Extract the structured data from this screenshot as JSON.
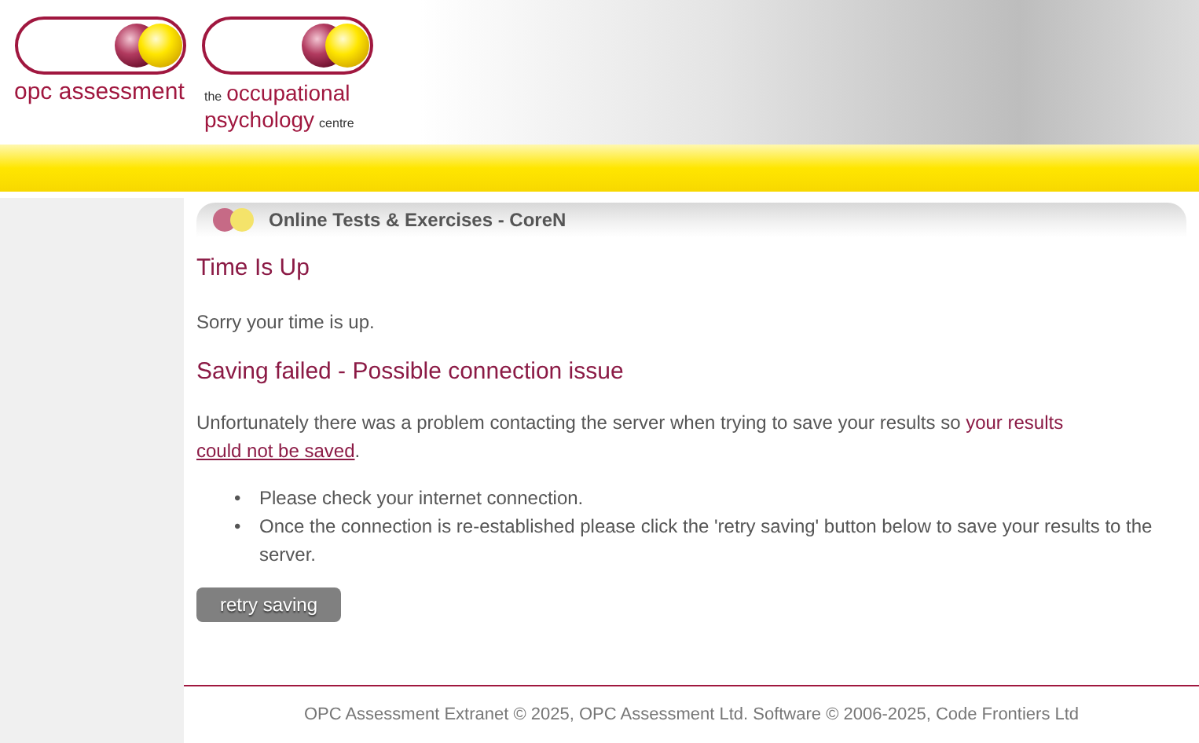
{
  "header": {
    "logos": [
      {
        "lines": [
          "opc assessment"
        ]
      },
      {
        "lines": [
          [
            {
              "text": "the",
              "small": true
            },
            {
              "text": "occupational",
              "small": false
            }
          ],
          [
            {
              "text": "psychology",
              "small": false
            },
            {
              "text": "centre",
              "small": true
            }
          ]
        ]
      }
    ]
  },
  "panel": {
    "title": "Online Tests & Exercises - CoreN"
  },
  "content": {
    "heading": "Time Is Up",
    "message": "Sorry your time is up.",
    "error_heading": "Saving failed - Possible connection issue",
    "paragraph": {
      "text": "Unfortunately there was a problem contacting the server when trying to save your results so ",
      "highlight": "your results",
      "link": "could not be saved",
      "end": "."
    },
    "bullets": [
      {
        "marker": "•",
        "text": "Please check your internet connection."
      },
      {
        "marker": "•",
        "text": "Once the connection is re-established please click the 'retry saving' button below to save your results to the server."
      }
    ],
    "button": "retry saving"
  },
  "footer": "OPC Assessment Extranet © 2025, OPC Assessment Ltd. Software © 2006-2025, Code Frontiers Ltd"
}
